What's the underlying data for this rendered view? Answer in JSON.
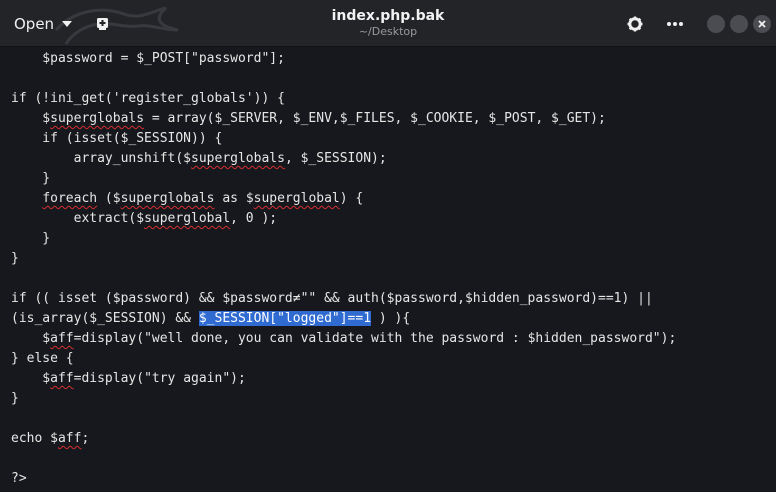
{
  "header": {
    "open_label": "Open",
    "title": "index.php.bak",
    "subtitle": "~/Desktop"
  },
  "icons": {
    "open_caret": "caret-down-icon",
    "new_document": "new-document-icon",
    "settings": "gear-icon",
    "menu": "more-icon",
    "minimize": "minimize-icon",
    "maximize": "maximize-icon",
    "close": "close-icon"
  },
  "colors": {
    "background": "#17181d",
    "titlebar": "#232428",
    "selection": "#2f6bd1",
    "spellcheck": "#d03030"
  },
  "code": {
    "l1": "    $password = $_POST[\"password\"];",
    "l3": "if (!ini_get('register_globals')) {",
    "l4a": "    $",
    "l4b": "superglobals",
    "l4c": " = array($_SERVER, $_ENV,$_FILES, $_COOKIE, $_POST, $_GET);",
    "l5": "    if (isset($_SESSION)) {",
    "l6a": "        array_unshift($",
    "l6b": "superglobals",
    "l6c": ", $_SESSION);",
    "l7": "    }",
    "l8a": "    ",
    "l8b": "foreach",
    "l8c": " ($",
    "l8d": "superglobals",
    "l8e": " as $",
    "l8f": "superglobal",
    "l8g": ") {",
    "l9a": "        extract($",
    "l9b": "superglobal",
    "l9c": ", 0 );",
    "l10": "    }",
    "l11": "}",
    "l13": "if (( isset ($password) && $password≠\"\" && auth($password,$hidden_password)==1) ||",
    "l14a": "(is_array($_SESSION) && ",
    "l14b": "$_SESSION[\"logged\"]==1",
    "l14c": " ) ){",
    "l15a": "    $",
    "l15b": "aff",
    "l15c": "=display(\"well done, you can validate with the password : $hidden_password\");",
    "l16": "} else {",
    "l17a": "    $",
    "l17b": "aff",
    "l17c": "=display(\"try again\");",
    "l18": "}",
    "l20a": "echo $",
    "l20b": "aff",
    "l20c": ";",
    "l22": "?>"
  }
}
